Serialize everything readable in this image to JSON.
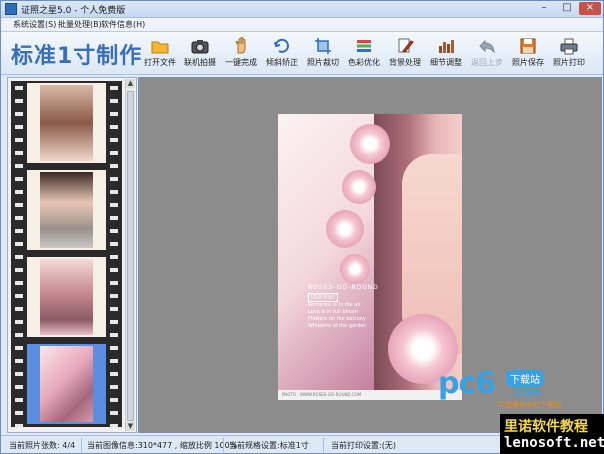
{
  "window": {
    "title": "证照之星5.0 - 个人免费版",
    "controls": [
      "–",
      "□",
      "×"
    ]
  },
  "menu": [
    {
      "label": "系统设置(S)"
    },
    {
      "label": "批量处理(B)"
    },
    {
      "label": "软件信息(H)"
    }
  ],
  "toolbar": {
    "heading": "标准1寸制作",
    "tools": [
      {
        "label": "打开文件",
        "icon": "folder-icon",
        "enabled": true
      },
      {
        "label": "联机拍摄",
        "icon": "camera-icon",
        "enabled": true
      },
      {
        "label": "一键完成",
        "icon": "hand-icon",
        "enabled": true
      },
      {
        "label": "倾斜矫正",
        "icon": "rotate-icon",
        "enabled": true
      },
      {
        "label": "照片裁切",
        "icon": "crop-icon",
        "enabled": true
      },
      {
        "label": "色彩优化",
        "icon": "color-icon",
        "enabled": true
      },
      {
        "label": "背景处理",
        "icon": "brush-icon",
        "enabled": true
      },
      {
        "label": "细节调整",
        "icon": "detail-icon",
        "enabled": true
      },
      {
        "label": "返回上步",
        "icon": "undo-icon",
        "enabled": false
      },
      {
        "label": "照片保存",
        "icon": "save-icon",
        "enabled": true
      },
      {
        "label": "照片打印",
        "icon": "printer-icon",
        "enabled": true
      }
    ]
  },
  "filmstrip": {
    "selected_index": 3,
    "frame_count": 4
  },
  "photo": {
    "title": "ROSES-GO-ROUND",
    "tag": "[恋爱花园]",
    "lines": [
      "Romance is in the air",
      "Love is in full bloom",
      "Flowers on the balcony",
      "Whispers of the garden"
    ],
    "footer": "PHOTO : WWW.ROSES-GO-ROUND.COM"
  },
  "status": {
    "count": "当前照片张数: 4/4",
    "image_info": "当前图像信息:310*477 , 缩放比例 100%",
    "spec": "当前规格设置:标准1寸",
    "print": "当前打印设置:(无)"
  },
  "watermarks": {
    "pc6_logo": "pc6",
    "pc6_badge": "下载站",
    "pc6_domain": ".com",
    "pc6_slogan": "中国最安全的下载站",
    "lenosoft_cn": "里诺软件教程",
    "lenosoft_url": "lenosoft.net"
  },
  "colors": {
    "accent": "#3a6fb6",
    "selected_frame": "#5b8de0",
    "canvas_bg": "#8c8c8c"
  }
}
